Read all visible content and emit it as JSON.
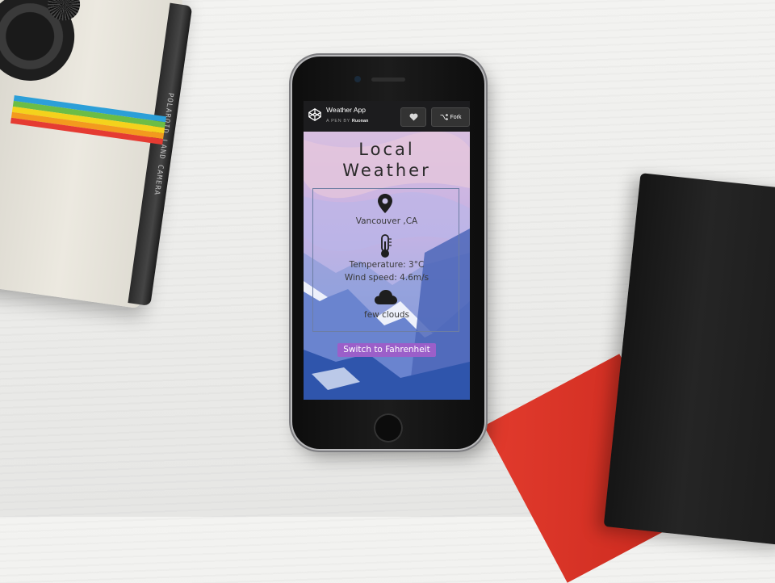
{
  "codepen_header": {
    "title": "Weather App",
    "byline_prefix": "A PEN BY",
    "author": "Ruonan",
    "fork_label": "Fork"
  },
  "app": {
    "title_line1": "Local",
    "title_line2": "Weather",
    "location": "Vancouver ,CA",
    "temperature_text": "Temperature: 3°C",
    "wind_speed_text": "Wind speed: 4.6m/s",
    "condition": "few clouds",
    "switch_button_label": "Switch to Fahrenheit"
  },
  "camera": {
    "side_label": "POLAROID LAND CAMERA"
  },
  "icons": {
    "location": "map-marker-icon",
    "temperature": "thermometer-icon",
    "condition": "cloud-icon",
    "heart": "heart-icon",
    "fork": "fork-icon",
    "logo": "codepen-logo-icon"
  },
  "colors": {
    "accent_button": "#9b5fc9",
    "header_bg": "#1c1c1e",
    "card_border": "#6d7ea3"
  }
}
